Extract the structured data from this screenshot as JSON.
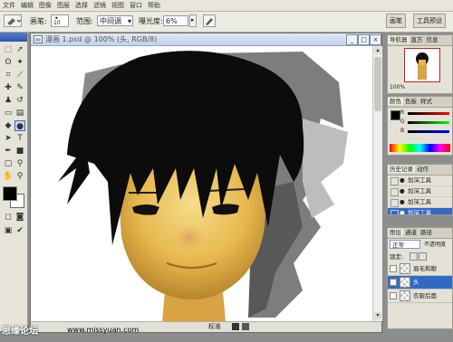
{
  "app": {
    "title": ""
  },
  "menubar": {
    "items": [
      "文件",
      "编辑",
      "图像",
      "图层",
      "选择",
      "滤镜",
      "视图",
      "窗口",
      "帮助"
    ]
  },
  "options": {
    "brush_label": "画笔:",
    "brush_size": "10",
    "range_label": "范围:",
    "range_value": "中间调",
    "exposure_label": "曝光度:",
    "exposure_value": "6%"
  },
  "right_top_tabs": [
    "画笔",
    "工具预设"
  ],
  "document": {
    "title": "漫画  1.psd @ 100% (头, RGB/8)",
    "status_zoom": "100%",
    "status_text": "标准"
  },
  "navigator": {
    "tabs": [
      "导航器",
      "直方",
      "信息"
    ],
    "zoom": "100%"
  },
  "color": {
    "tabs": [
      "颜色",
      "色板",
      "样式"
    ],
    "channels": [
      "R",
      "G",
      "B"
    ]
  },
  "history": {
    "tabs": [
      "历史记录",
      "动作"
    ],
    "items": [
      "加深工具",
      "加深工具",
      "加深工具",
      "加深工具"
    ]
  },
  "layers": {
    "tabs": [
      "图层",
      "通道",
      "路径"
    ],
    "blend_mode": "正常",
    "opacity_label": "不透明度",
    "lock_label": "锁定:",
    "items": [
      "眉毛和眼",
      "头",
      "衣服后面"
    ]
  },
  "watermark": {
    "left": "思缘论坛",
    "url": "www.missyuan.com"
  },
  "colors": {
    "menubar": "#e8e6dc",
    "accent": "#316ac5"
  }
}
